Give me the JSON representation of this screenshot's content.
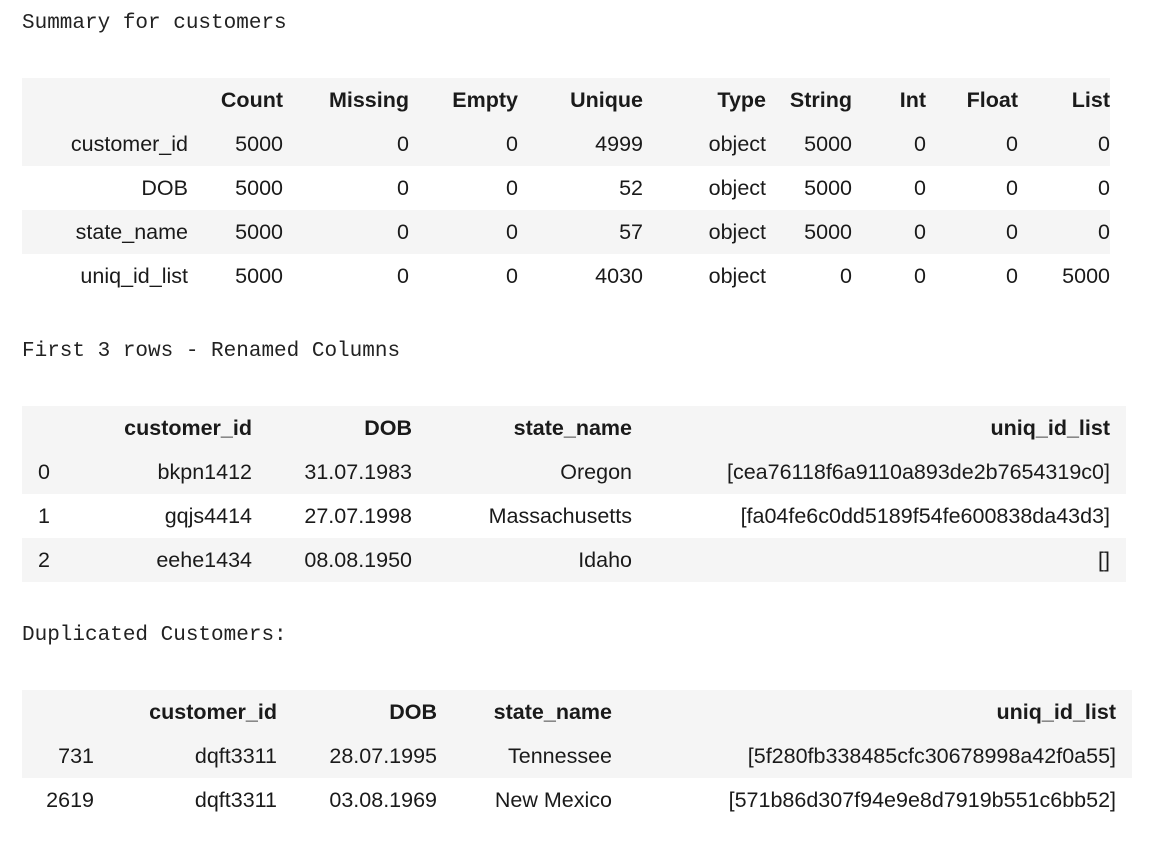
{
  "summary": {
    "caption": "Summary for customers",
    "columns": [
      "",
      "Count",
      "Missing",
      "Empty",
      "Unique",
      "Type",
      "String",
      "Int",
      "Float",
      "List"
    ],
    "rows": [
      [
        "customer_id",
        "5000",
        "0",
        "0",
        "4999",
        "object",
        "5000",
        "0",
        "0",
        "0"
      ],
      [
        "DOB",
        "5000",
        "0",
        "0",
        "52",
        "object",
        "5000",
        "0",
        "0",
        "0"
      ],
      [
        "state_name",
        "5000",
        "0",
        "0",
        "57",
        "object",
        "5000",
        "0",
        "0",
        "0"
      ],
      [
        "uniq_id_list",
        "5000",
        "0",
        "0",
        "4030",
        "object",
        "0",
        "0",
        "0",
        "5000"
      ]
    ]
  },
  "first_rows": {
    "caption": "First 3 rows - Renamed Columns",
    "columns": [
      "",
      "customer_id",
      "DOB",
      "state_name",
      "uniq_id_list"
    ],
    "rows": [
      [
        "0",
        "bkpn1412",
        "31.07.1983",
        "Oregon",
        "[cea76118f6a9110a893de2b7654319c0]"
      ],
      [
        "1",
        "gqjs4414",
        "27.07.1998",
        "Massachusetts",
        "[fa04fe6c0dd5189f54fe600838da43d3]"
      ],
      [
        "2",
        "eehe1434",
        "08.08.1950",
        "Idaho",
        "[]"
      ]
    ]
  },
  "duplicates": {
    "caption": "Duplicated Customers:",
    "columns": [
      "",
      "customer_id",
      "DOB",
      "state_name",
      "uniq_id_list"
    ],
    "rows": [
      [
        "731",
        "dqft3311",
        "28.07.1995",
        "Tennessee",
        "[5f280fb338485cfc30678998a42f0a55]"
      ],
      [
        "2619",
        "dqft3311",
        "03.08.1969",
        "New Mexico",
        "[571b86d307f94e9e8d7919b551c6bb52]"
      ]
    ]
  }
}
